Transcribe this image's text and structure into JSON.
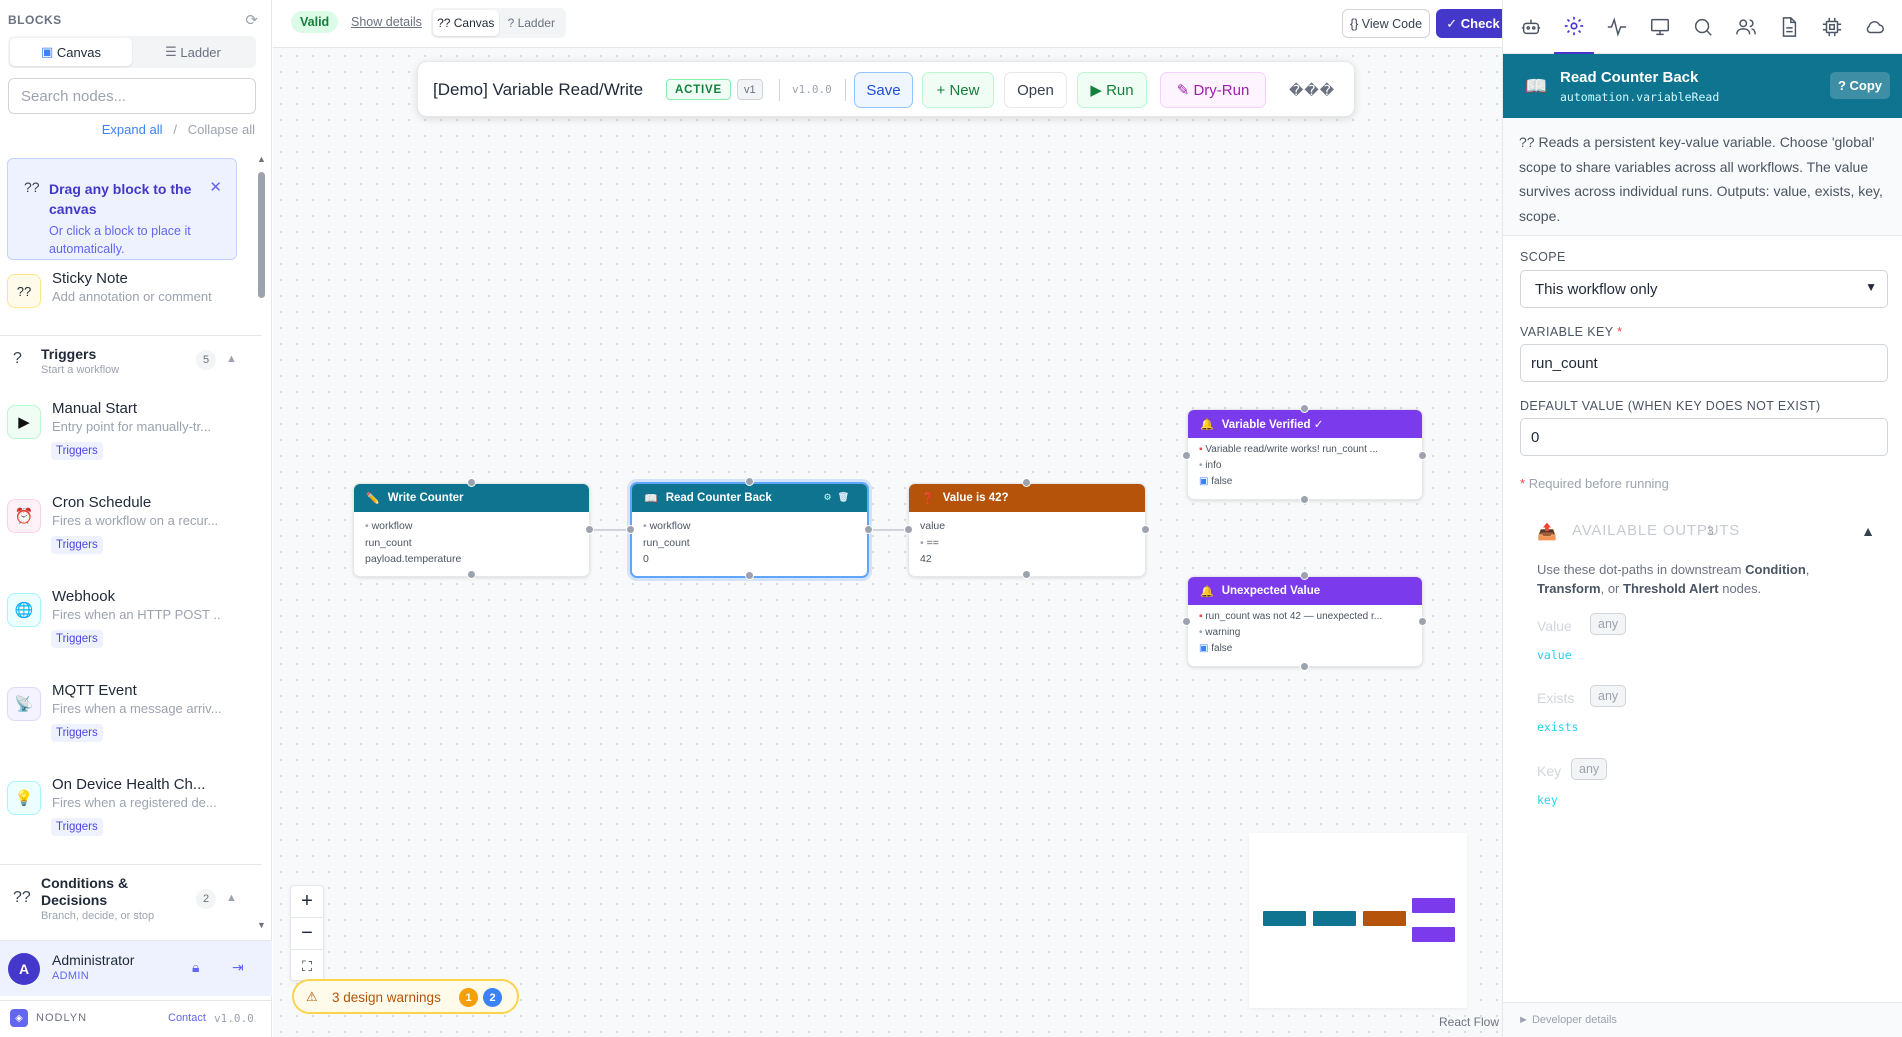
{
  "sidebar": {
    "title": "BLOCKS",
    "view_canvas": "Canvas",
    "view_ladder": "Ladder",
    "search_placeholder": "Search nodes...",
    "expand_all": "Expand all",
    "collapse_all": "Collapse all",
    "hint": {
      "icon": "??",
      "title": "Drag any block to the canvas",
      "sub": "Or click a block to place it automatically."
    },
    "sticky": {
      "icon": "??",
      "name": "Sticky Note",
      "desc": "Add annotation or comment"
    },
    "triggers": {
      "icon": "?",
      "name": "Triggers",
      "desc": "Start a workflow",
      "count": "5"
    },
    "items": [
      {
        "name": "Manual Start",
        "desc": "Entry point for manually-tr...",
        "tag": "Triggers",
        "icon": "▶"
      },
      {
        "name": "Cron Schedule",
        "desc": "Fires a workflow on a recur...",
        "tag": "Triggers",
        "icon": "⏰"
      },
      {
        "name": "Webhook",
        "desc": "Fires when an HTTP POST ...",
        "tag": "Triggers",
        "icon": "🌐"
      },
      {
        "name": "MQTT Event",
        "desc": "Fires when a message arriv...",
        "tag": "Triggers",
        "icon": "📡"
      },
      {
        "name": "On Device Health Ch...",
        "desc": "Fires when a registered de...",
        "tag": "Triggers",
        "icon": "💡"
      }
    ],
    "conditions": {
      "icon": "??",
      "name": "Conditions & Decisions",
      "desc": "Branch, decide, or stop",
      "count": "2"
    },
    "user": {
      "initial": "A",
      "name": "Administrator",
      "role": "ADMIN"
    },
    "footer": {
      "brand": "NODLYN",
      "contact": "Contact",
      "version": "v1.0.0"
    }
  },
  "topbar": {
    "valid": "Valid",
    "show_details": "Show details",
    "mode_canvas": "?? Canvas",
    "mode_ladder": "? Ladder",
    "view_code": "{} View Code",
    "check": "✓ Check"
  },
  "workflow": {
    "title": "[Demo] Variable Read/Write",
    "status": "ACTIVE",
    "rev": "v1",
    "version": "v1.0.0",
    "save": "Save",
    "new": "+ New",
    "open": "Open",
    "run": "▶ Run",
    "dry_run": "Dry-Run",
    "overflow": "���"
  },
  "nodes": {
    "write": {
      "title": "Write Counter",
      "icon": "✏️",
      "l1": "workflow",
      "l2": "run_count",
      "l3": "payload.temperature"
    },
    "read": {
      "title": "Read Counter Back",
      "icon": "📖",
      "l1": "workflow",
      "l2": "run_count",
      "l3": "0"
    },
    "cond": {
      "title": "Value is 42?",
      "icon": "❓",
      "l1": "value",
      "l2": "==",
      "l3": "42"
    },
    "verified": {
      "title": "Variable Verified ✓",
      "icon": "🔔",
      "l1": "Variable read/write works! run_count ...",
      "l2": "info",
      "l3": "false"
    },
    "unexpected": {
      "title": "Unexpected Value",
      "icon": "🔔",
      "l1": "run_count was not 42 — unexpected r...",
      "l2": "warning",
      "l3": "false"
    }
  },
  "canvas": {
    "zoom_in": "+",
    "zoom_out": "−",
    "fit": "⛶",
    "warnings": "3 design warnings",
    "warn_a": "1",
    "warn_b": "2",
    "attribution": "React Flow"
  },
  "panel": {
    "block_name": "Read Counter Back",
    "block_type": "automation.variableRead",
    "copy": "? Copy",
    "description": "?? Reads a persistent key-value variable. Choose 'global' scope to share variables across all workflows. The value survives across individual runs. Outputs: value, exists, key, scope.",
    "scope_label": "SCOPE",
    "scope_value": "This workflow only",
    "key_label": "VARIABLE KEY",
    "key_value": "run_count",
    "default_label": "DEFAULT VALUE (WHEN KEY DOES NOT EXIST)",
    "default_value": "0",
    "required_note": "Required before running",
    "outputs": {
      "title": "AVAILABLE OUTPUTS",
      "count": "3",
      "intro": "Use these dot-paths in downstream",
      "cond": "Condition",
      "transform": "Transform",
      "or": "or",
      "threshold": "Threshold Alert",
      "tail": "nodes.",
      "items": [
        {
          "label": "Value",
          "type": "any",
          "path": "value"
        },
        {
          "label": "Exists",
          "type": "any",
          "path": "exists"
        },
        {
          "label": "Key",
          "type": "any",
          "path": "key"
        }
      ]
    },
    "developer": "► Developer details"
  },
  "colors": {
    "accent": "#4338ca",
    "teal": "#0e7490",
    "orange": "#b45309",
    "purple": "#7c3aed"
  }
}
